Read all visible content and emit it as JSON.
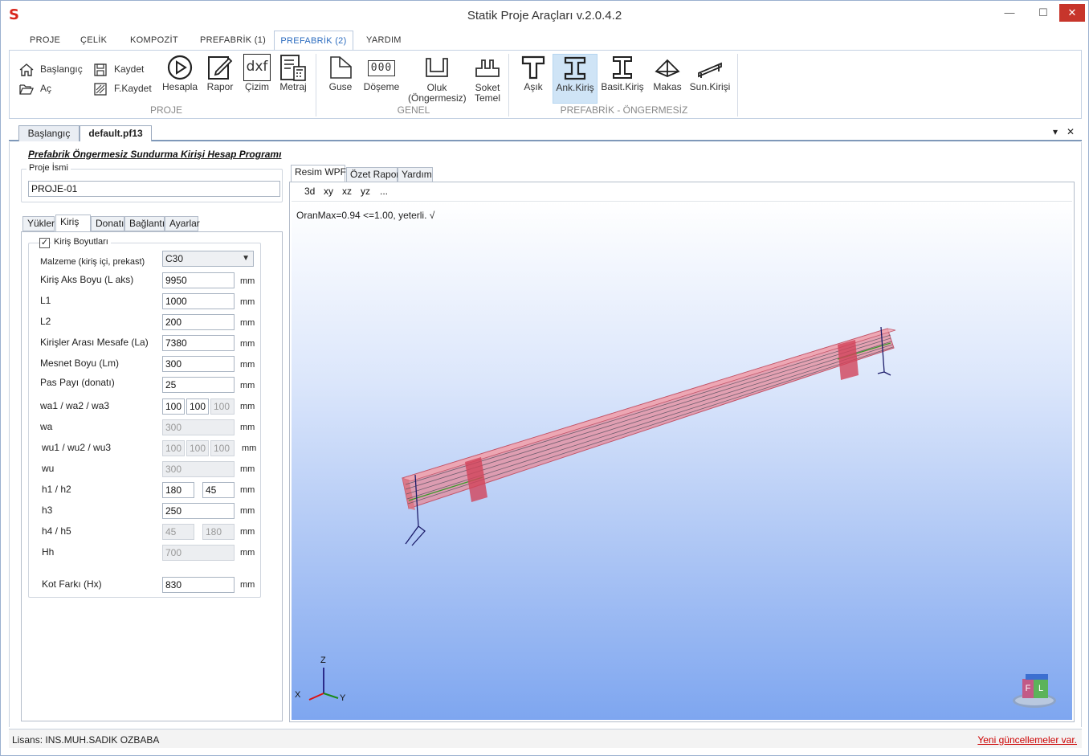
{
  "window": {
    "title": "Statik Proje Araçları v.2.0.4.2",
    "minimize": "—",
    "maximize": "☐",
    "close": "✕"
  },
  "menu": {
    "tabs": [
      "PROJE",
      "ÇELİK",
      "KOMPOZİT",
      "PREFABRİK (1)",
      "PREFABRİK (2)",
      "YARDIM"
    ],
    "active": "PREFABRİK (2)"
  },
  "ribbon": {
    "proje": {
      "label": "PROJE",
      "baslangic": "Başlangıç",
      "ac": "Aç",
      "kaydet": "Kaydet",
      "fkaydet": "F.Kaydet",
      "hesapla": "Hesapla",
      "rapor": "Rapor",
      "cizim": "Çizim",
      "metraj": "Metraj",
      "dxf": "dxf"
    },
    "genel": {
      "label": "GENEL",
      "guse": "Guse",
      "doseme": "Döşeme",
      "oluk_line1": "Oluk",
      "oluk_line2": "(Öngermesiz)",
      "soket_line1": "Soket",
      "soket_line2": "Temel",
      "doseme_icon_text": "000"
    },
    "prefabrik": {
      "label": "PREFABRİK - ÖNGERMESİZ",
      "asik": "Aşık",
      "ank_kiris": "Ank.Kiriş",
      "basit_kiris": "Basit.Kiriş",
      "makas": "Makas",
      "sun_kirisi": "Sun.Kirişi"
    }
  },
  "doc_tabs": {
    "start": "Başlangıç",
    "file": "default.pf13",
    "menu_arrow": "▾",
    "close": "✕"
  },
  "form": {
    "program_title": "Prefabrik Öngermesiz Sundurma Kirişi Hesap Programı",
    "project_name_label": "Proje İsmi",
    "project_name": "PROJE-01",
    "tabs": [
      "Yükler",
      "Kiriş",
      "Donatı",
      "Bağlantı",
      "Ayarlar"
    ],
    "active_tab": "Kiriş",
    "group_label": "Kiriş Boyutları",
    "group_checked": "✓",
    "material_label": "Malzeme (kiriş içi, prekast)",
    "material_value": "C30",
    "rows": {
      "lx_label": "Kiriş Aks Boyu (L aks)",
      "lx": "9950",
      "l1_label": "L1",
      "l1": "1000",
      "l2_label": "L2",
      "l2": "200",
      "la_label": "Kirişler Arası Mesafe (La)",
      "la": "7380",
      "lm_label": "Mesnet Boyu (Lm)",
      "lm": "300",
      "pas_label": "Pas Payı (donatı)",
      "pas": "25",
      "wa123_label": "wa1 / wa2 / wa3",
      "wa1": "100",
      "wa2": "100",
      "wa3": "100",
      "wa_label": "wa",
      "wa": "300",
      "wu123_label": "wu1 / wu2 / wu3",
      "wu1": "100",
      "wu2": "100",
      "wu3": "100",
      "wu_label": "wu",
      "wu": "300",
      "h12_label": "h1 / h2",
      "h1": "180",
      "h2": "45",
      "h3_label": "h3",
      "h3": "250",
      "h45_label": "h4 / h5",
      "h4": "45",
      "h5": "180",
      "hh_label": "Hh",
      "hh": "700",
      "hx_label": "Kot Farkı (Hx)",
      "hx": "830"
    },
    "unit": "mm"
  },
  "viewer": {
    "tabs": [
      "Resim WPF",
      "Özet Rapor",
      "Yardım"
    ],
    "active_tab": "Resim WPF",
    "toolbar": [
      "3d",
      "xy",
      "xz",
      "yz",
      "..."
    ],
    "result_text": "OranMax=0.94 <=1.00, yeterli. √",
    "axis_z": "Z",
    "axis_x": "X",
    "axis_y": "Y",
    "cube_f": "F",
    "cube_l": "L"
  },
  "statusbar": {
    "license": "Lisans: INS.MUH.SADIK OZBABA",
    "update": "Yeni güncellemeler var."
  }
}
